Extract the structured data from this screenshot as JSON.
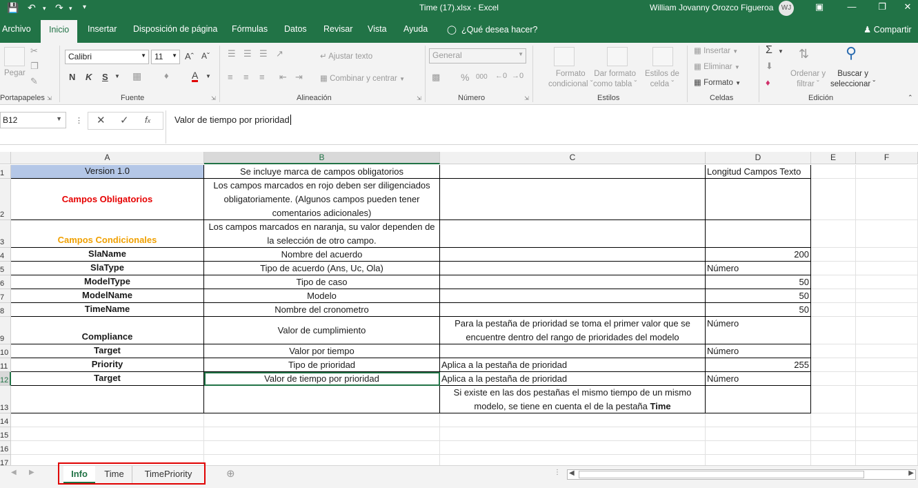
{
  "title_bar": {
    "file_title": "Time (17).xlsx  -  Excel",
    "user_name": "William Jovanny Orozco Figueroa",
    "user_initials": "WJ"
  },
  "ribbon_tabs": [
    "Archivo",
    "Inicio",
    "Insertar",
    "Disposición de página",
    "Fórmulas",
    "Datos",
    "Revisar",
    "Vista",
    "Ayuda"
  ],
  "tell_me": "¿Qué desea hacer?",
  "share": "Compartir",
  "ribbon": {
    "clipboard": {
      "paste": "Pegar",
      "label": "Portapapeles"
    },
    "font": {
      "name": "Calibri",
      "size": "11",
      "label": "Fuente",
      "bold": "N",
      "italic": "K",
      "underline": "S"
    },
    "alignment": {
      "wrap": "Ajustar texto",
      "merge": "Combinar y centrar",
      "label": "Alineación"
    },
    "number": {
      "format": "General",
      "percent": "%",
      "thousands": "000",
      "label": "Número"
    },
    "styles": {
      "conditional_1": "Formato",
      "conditional_2": "condicional",
      "table_1": "Dar formato",
      "table_2": "como tabla",
      "cell_1": "Estilos de",
      "cell_2": "celda",
      "label": "Estilos"
    },
    "cells": {
      "insert": "Insertar",
      "delete": "Eliminar",
      "format": "Formato",
      "label": "Celdas"
    },
    "editing": {
      "sort_1": "Ordenar y",
      "sort_2": "filtrar",
      "find_1": "Buscar y",
      "find_2": "seleccionar",
      "label": "Edición"
    }
  },
  "formula_bar": {
    "name_box": "B12",
    "formula": "Valor de tiempo por prioridad"
  },
  "columns": [
    "A",
    "B",
    "C",
    "D",
    "E",
    "F"
  ],
  "rows": [
    {
      "num": "1",
      "A": "Version 1.0",
      "B": "Se incluye marca de campos obligatorios",
      "C": "",
      "D": "Longitud Campos Texto"
    },
    {
      "num": "2",
      "A": "Campos Obligatorios",
      "B": "Los campos marcados en rojo deben ser diligenciados obligatoriamente. (Algunos campos pueden tener comentarios adicionales)",
      "C": "",
      "D": ""
    },
    {
      "num": "3",
      "A": "Campos Condicionales",
      "B": "Los campos marcados en naranja, su valor dependen de la selección de otro campo.",
      "C": "",
      "D": ""
    },
    {
      "num": "4",
      "A": "SlaName",
      "B": "Nombre del acuerdo",
      "C": "",
      "D": "200"
    },
    {
      "num": "5",
      "A": "SlaType",
      "B": "Tipo de acuerdo (Ans, Uc, Ola)",
      "C": "",
      "D": "Número"
    },
    {
      "num": "6",
      "A": "ModelType",
      "B": "Tipo de caso",
      "C": "",
      "D": "50"
    },
    {
      "num": "7",
      "A": "ModelName",
      "B": "Modelo",
      "C": "",
      "D": "50"
    },
    {
      "num": "8",
      "A": "TimeName",
      "B": "Nombre del cronometro",
      "C": "",
      "D": "50"
    },
    {
      "num": "9",
      "A": "Compliance",
      "B": "Valor de cumplimiento",
      "C": "Para la pestaña de prioridad se toma el primer valor que se encuentre dentro del rango de prioridades del modelo",
      "D": "Número"
    },
    {
      "num": "10",
      "A": "Target",
      "B": "Valor por tiempo",
      "C": "",
      "D": "Número"
    },
    {
      "num": "11",
      "A": "Priority",
      "B": "Tipo de prioridad",
      "C": "Aplica a la pestaña de prioridad",
      "D": "255"
    },
    {
      "num": "12",
      "A": "Target",
      "B": "Valor de tiempo por prioridad",
      "C": "Aplica a la pestaña de prioridad",
      "D": "Número"
    },
    {
      "num": "13",
      "A": "",
      "B": "",
      "C": "Si existe en las dos pestañas el mismo tiempo de un mismo modelo, se tiene en cuenta el de la pestaña",
      "C_bold": "Time",
      "D": ""
    },
    {
      "num": "14"
    },
    {
      "num": "15"
    },
    {
      "num": "16"
    },
    {
      "num": "17"
    }
  ],
  "sheets": [
    "Info",
    "Time",
    "TimePriority"
  ],
  "colors": {
    "excel_green": "#217346",
    "required_red": "#e60000",
    "conditional_orange": "#f0a000",
    "header_blue": "#b4c7e7"
  }
}
